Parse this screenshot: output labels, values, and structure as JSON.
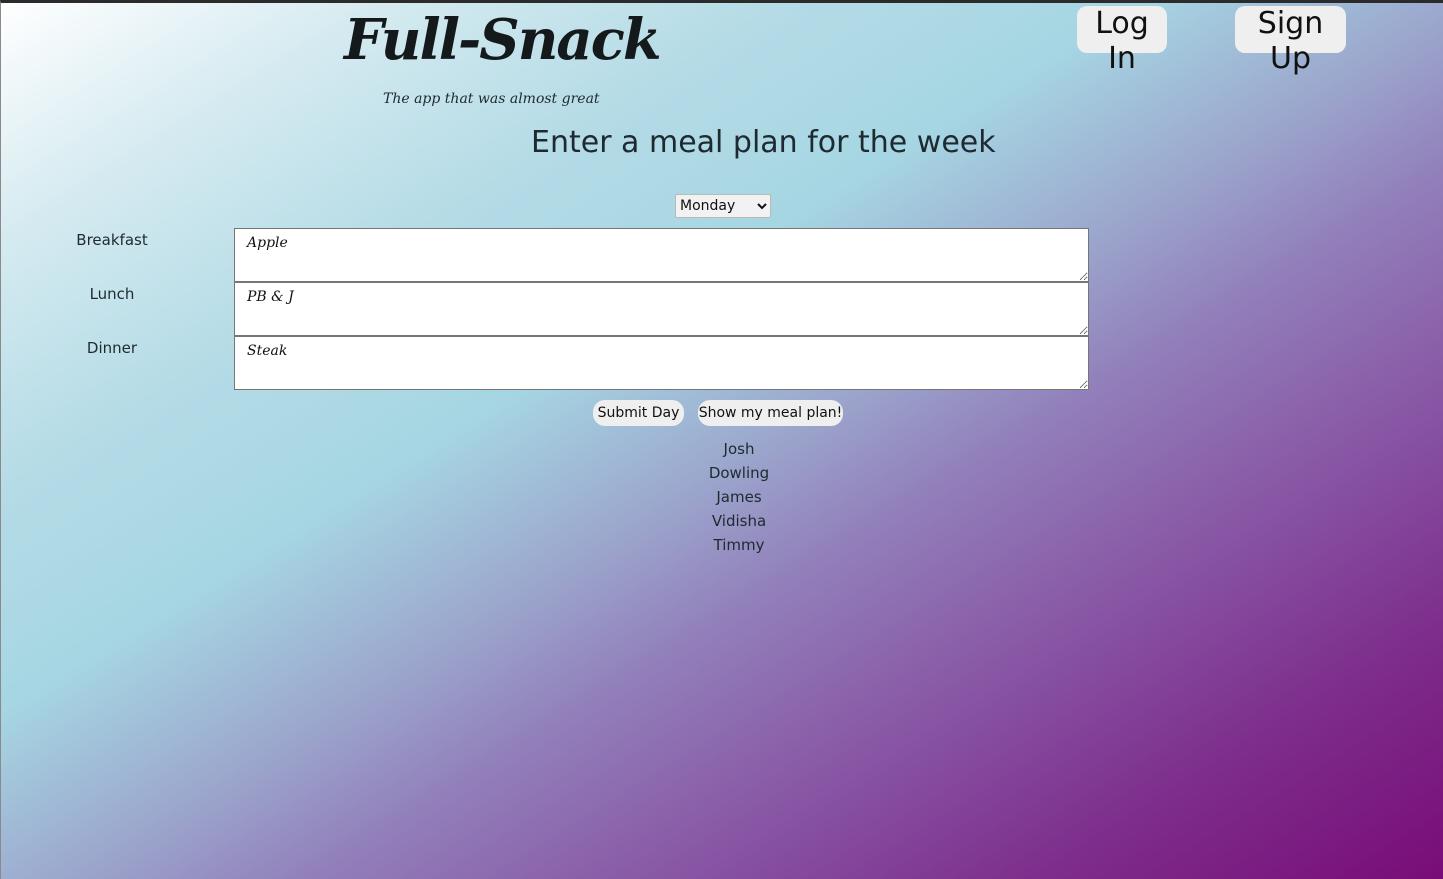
{
  "header": {
    "logo": "Full-Snack",
    "tagline": "The app that was almost great"
  },
  "auth": {
    "login_label": "Log In",
    "signup_label": "Sign Up"
  },
  "main": {
    "heading": "Enter a meal plan for the week",
    "day_select": {
      "selected": "Monday"
    },
    "meals": [
      {
        "label": "Breakfast",
        "value": "Apple"
      },
      {
        "label": "Lunch",
        "value": "PB & J"
      },
      {
        "label": "Dinner",
        "value": "Steak"
      }
    ],
    "submit_label": "Submit Day",
    "show_label": "Show my meal plan!"
  },
  "team": [
    "Josh",
    "Dowling",
    "James",
    "Vidisha",
    "Timmy"
  ]
}
